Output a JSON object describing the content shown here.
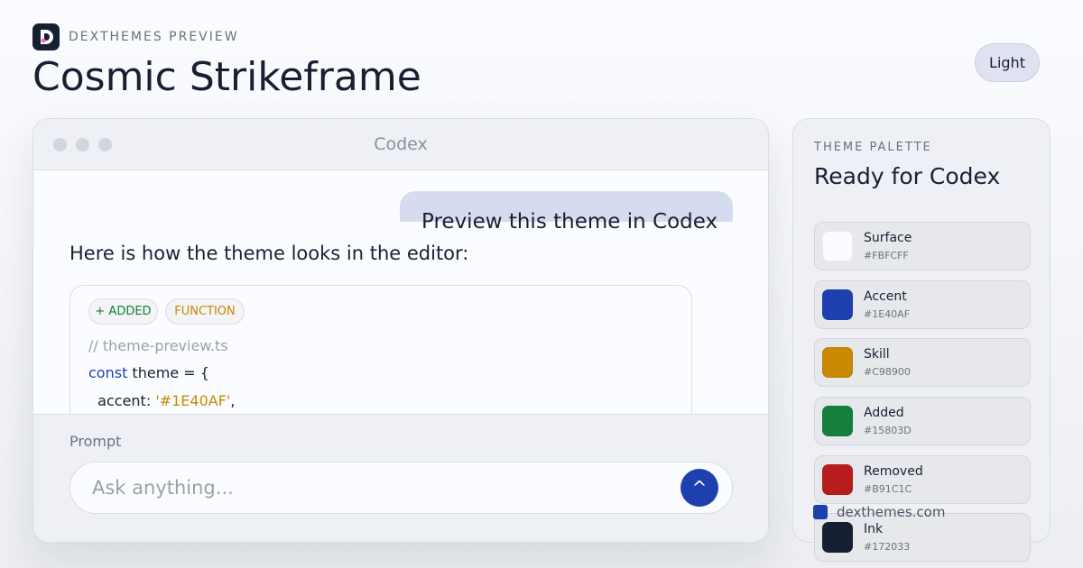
{
  "header": {
    "brand_label": "DEXTHEMES PREVIEW",
    "title": "Cosmic Strikeframe",
    "mode_label": "Light"
  },
  "app": {
    "window_title": "Codex",
    "user_message": "Preview this theme in Codex",
    "assistant_message": "Here is how the theme looks in the editor:",
    "chips": {
      "added": "+ ADDED",
      "function": "FUNCTION"
    },
    "code": {
      "comment": "// theme-preview.ts",
      "keyword": "const",
      "declaration": " theme = {",
      "property": "  accent: ",
      "string": "'#1E40AF'",
      "trailing": ","
    },
    "prompt_label": "Prompt",
    "prompt_placeholder": "Ask anything...",
    "send_glyph": "^"
  },
  "palette": {
    "eyebrow": "THEME PALETTE",
    "title": "Ready for Codex",
    "swatches": [
      {
        "name": "Surface",
        "hex": "#FBFCFF",
        "color": "#FBFCFF"
      },
      {
        "name": "Accent",
        "hex": "#1E40AF",
        "color": "#1E40AF"
      },
      {
        "name": "Skill",
        "hex": "#C98900",
        "color": "#C98900"
      },
      {
        "name": "Added",
        "hex": "#15803D",
        "color": "#15803D"
      },
      {
        "name": "Removed",
        "hex": "#B91C1C",
        "color": "#B91C1C"
      },
      {
        "name": "Ink",
        "hex": "#172033",
        "color": "#172033"
      }
    ]
  },
  "footer": {
    "site": "dexthemes.com",
    "site_dot_color": "#1E40AF"
  },
  "colors": {
    "accent": "#1E40AF",
    "skill": "#C98900",
    "added": "#15803D",
    "removed": "#B91C1C",
    "ink": "#172033",
    "surface": "#FBFCFF"
  },
  "icons": {
    "logo": "dexthemes-logo-icon",
    "send": "send-arrow-icon"
  }
}
